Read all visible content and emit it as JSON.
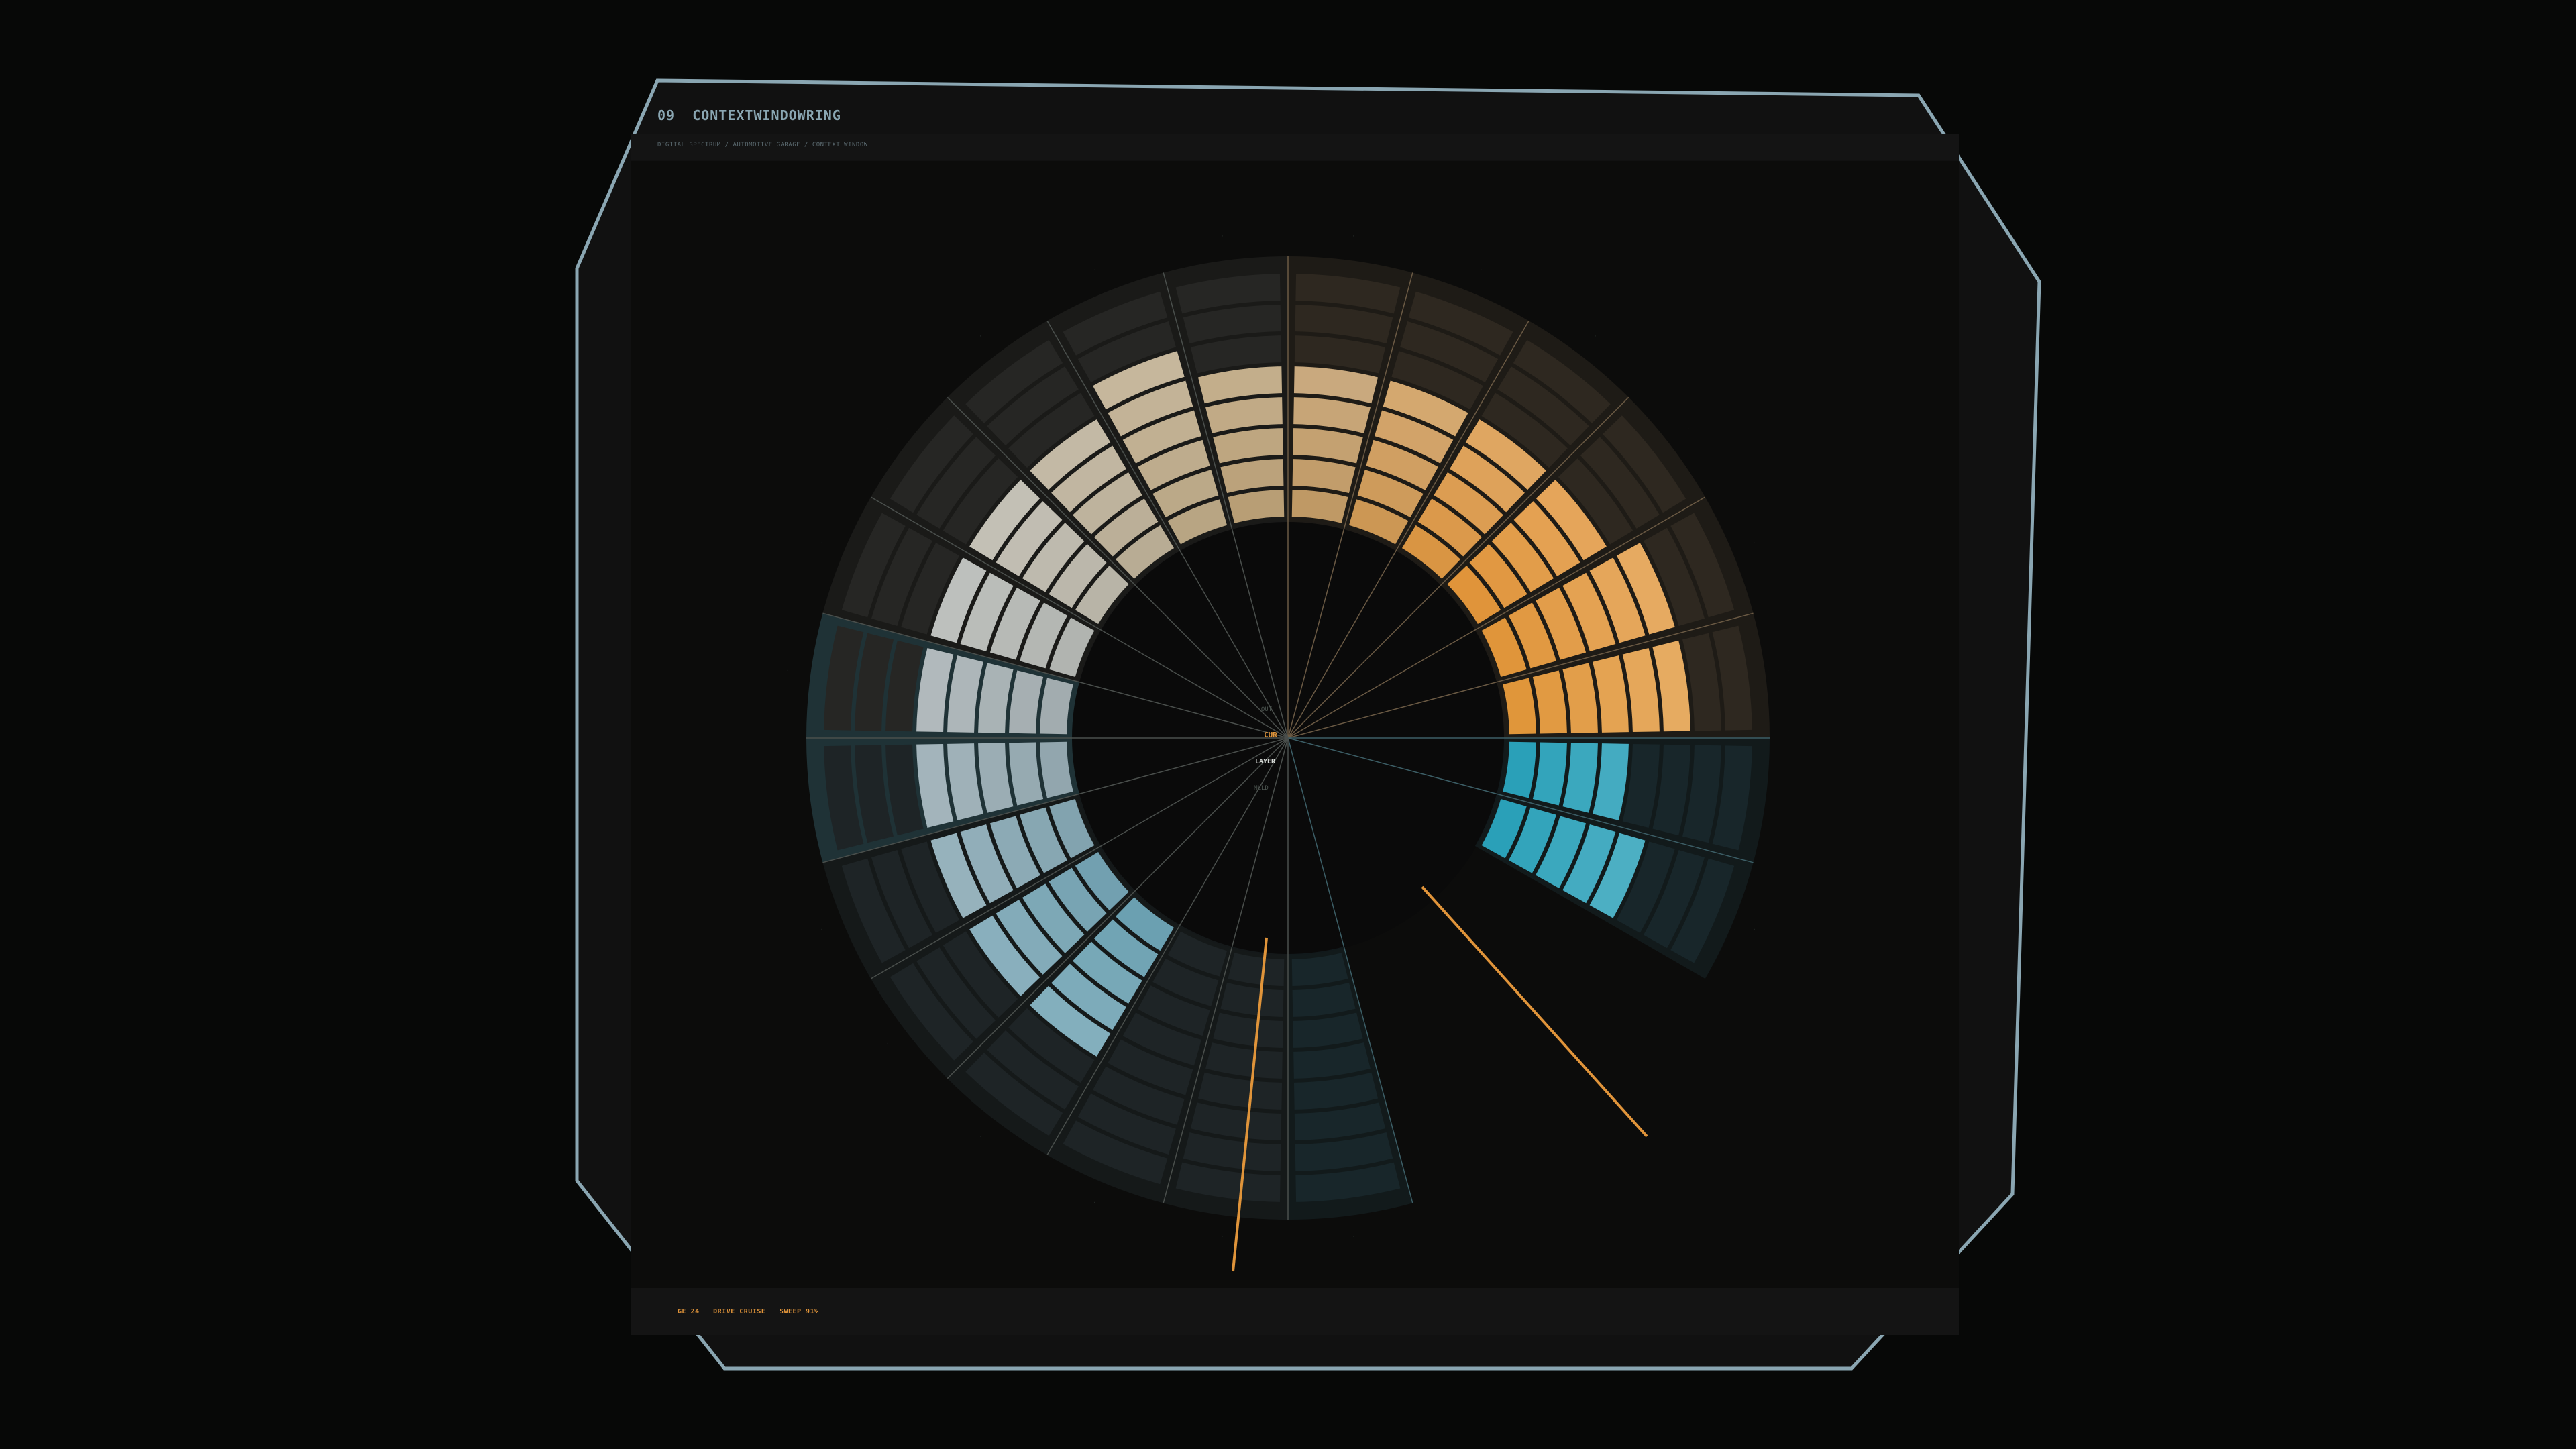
{
  "panel": {
    "number": "09",
    "title": "CONTEXTWINDOWRING",
    "subtitle": "DIGITAL SPECTRUM / AUTOMOTIVE GARAGE / CONTEXT WINDOW"
  },
  "center": {
    "top_label": "OUT",
    "cursor_label": "CUR",
    "layer_label": "LAYER",
    "bottom_label": "MLLD"
  },
  "status": {
    "left": "GE 24",
    "mode": "DRIVE CRUISE",
    "sweep": "SWEEP 91%"
  },
  "colors": {
    "accent": "#e0943a",
    "warm": "#e09a3d",
    "cool": "#2aa0b8",
    "frame": "#8aa6b2"
  },
  "chart_data": {
    "type": "radial-segmented-bars",
    "sectors": 24,
    "rings_per_sector": 8,
    "visible_sectors": 21,
    "lit_levels": [
      5,
      5,
      5,
      5,
      6,
      6,
      4,
      5,
      0,
      0,
      0,
      5,
      5,
      5,
      5,
      5,
      5,
      5,
      5,
      6,
      5,
      5,
      4,
      5
    ],
    "highlight_sectors": [
      14,
      15
    ],
    "cursor_sector": 8
  }
}
